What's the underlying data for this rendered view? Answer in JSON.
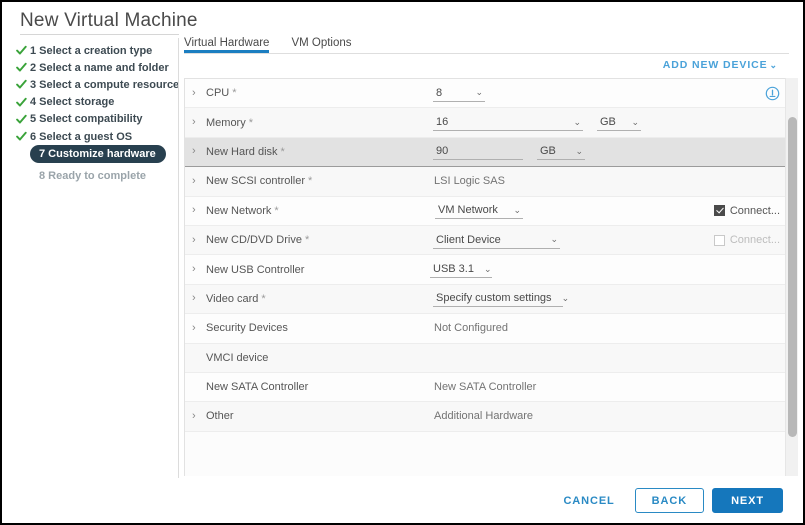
{
  "window": {
    "title": "New Virtual Machine"
  },
  "sidebar": {
    "steps": [
      {
        "label": "1 Select a creation type",
        "state": "done"
      },
      {
        "label": "2 Select a name and folder",
        "state": "done"
      },
      {
        "label": "3 Select a compute resource",
        "state": "done"
      },
      {
        "label": "4 Select storage",
        "state": "done"
      },
      {
        "label": "5 Select compatibility",
        "state": "done"
      },
      {
        "label": "6 Select a guest OS",
        "state": "done"
      },
      {
        "label": "7 Customize hardware",
        "state": "active"
      },
      {
        "label": "8 Ready to complete",
        "state": "pending"
      }
    ]
  },
  "tabs": [
    {
      "label": "Virtual Hardware",
      "active": true
    },
    {
      "label": "VM Options",
      "active": false
    }
  ],
  "toolbar": {
    "add_new_device_label": "ADD NEW DEVICE",
    "caret": "⌄"
  },
  "device_table": {
    "rows": [
      {
        "label": "CPU",
        "required": true,
        "expandable": true,
        "value": "8",
        "control": "select",
        "control_width": 52,
        "right": "info-icon"
      },
      {
        "label": "Memory",
        "required": true,
        "expandable": true,
        "value": "16",
        "control": "select",
        "control_width": 150,
        "unit": "GB",
        "unit_width": 44
      },
      {
        "label": "New Hard disk",
        "required": true,
        "expandable": true,
        "value": "90",
        "control": "input",
        "control_width": 90,
        "unit": "GB",
        "unit_width": 48,
        "selected": true
      },
      {
        "label": "New SCSI controller",
        "required": true,
        "expandable": true,
        "value": "LSI Logic SAS",
        "control": "text"
      },
      {
        "label": "New Network",
        "required": true,
        "expandable": true,
        "value": "VM Network",
        "control": "select",
        "control_width": 88,
        "right": "checkbox",
        "checkbox_label": "Connect...",
        "checkbox_checked": true,
        "checkbox_disabled": false
      },
      {
        "label": "New CD/DVD Drive",
        "required": true,
        "expandable": true,
        "value": "Client Device",
        "control": "select",
        "control_width": 127,
        "right": "checkbox",
        "checkbox_label": "Connect...",
        "checkbox_checked": false,
        "checkbox_disabled": true
      },
      {
        "label": "New USB Controller",
        "required": false,
        "expandable": true,
        "value": "USB 3.1",
        "control": "select",
        "control_width": 62
      },
      {
        "label": "Video card",
        "required": true,
        "expandable": true,
        "value": "Specify custom settings",
        "control": "select",
        "control_width": 130
      },
      {
        "label": "Security Devices",
        "required": false,
        "expandable": true,
        "value": "Not Configured",
        "control": "text"
      },
      {
        "label": "VMCI device",
        "required": false,
        "expandable": false,
        "value": "",
        "control": "text"
      },
      {
        "label": "New SATA Controller",
        "required": false,
        "expandable": false,
        "value": "New SATA Controller",
        "control": "text"
      },
      {
        "label": "Other",
        "required": false,
        "expandable": true,
        "value": "Additional Hardware",
        "control": "text"
      }
    ],
    "expander_glyph": "›",
    "required_glyph": "*"
  },
  "footer": {
    "cancel_label": "CANCEL",
    "back_label": "BACK",
    "next_label": "NEXT"
  },
  "colors": {
    "accent_blue": "#1577bc",
    "link_blue": "#4aa2d9",
    "active_step_bg": "#28404f",
    "check_green": "#3aa33a",
    "tab_underline": "#1b7ec1"
  }
}
